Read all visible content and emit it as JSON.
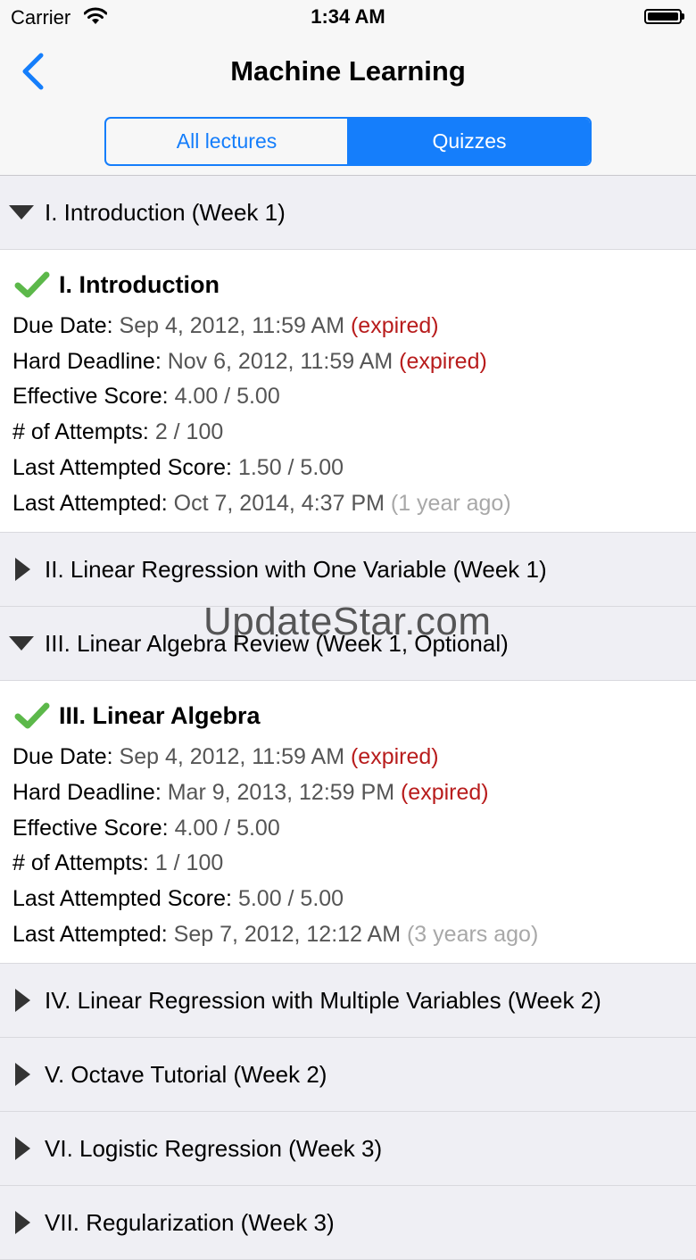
{
  "status": {
    "carrier": "Carrier",
    "time": "1:34 AM"
  },
  "nav": {
    "title": "Machine Learning",
    "tabs": [
      {
        "label": "All lectures",
        "active": false
      },
      {
        "label": "Quizzes",
        "active": true
      }
    ]
  },
  "sections": [
    {
      "title": "I. Introduction (Week 1)",
      "expanded": true,
      "quiz": {
        "title": "I. Introduction",
        "due_label": "Due Date:",
        "due_value": "Sep 4, 2012, 11:59 AM",
        "due_status": "(expired)",
        "hard_label": "Hard Deadline:",
        "hard_value": "Nov 6, 2012, 11:59 AM",
        "hard_status": "(expired)",
        "score_label": "Effective Score:",
        "score_value": "4.00 / 5.00",
        "attempts_label": "# of Attempts:",
        "attempts_value": "2 / 100",
        "last_score_label": "Last Attempted Score:",
        "last_score_value": "1.50 / 5.00",
        "last_label": "Last Attempted:",
        "last_value": "Oct 7, 2014, 4:37 PM",
        "last_ago": "(1 year ago)"
      }
    },
    {
      "title": "II. Linear Regression with One Variable (Week 1)",
      "expanded": false
    },
    {
      "title": "III. Linear Algebra Review (Week 1, Optional)",
      "expanded": true,
      "quiz": {
        "title": "III. Linear Algebra",
        "due_label": "Due Date:",
        "due_value": "Sep 4, 2012, 11:59 AM",
        "due_status": "(expired)",
        "hard_label": "Hard Deadline:",
        "hard_value": "Mar 9, 2013, 12:59 PM",
        "hard_status": "(expired)",
        "score_label": "Effective Score:",
        "score_value": "4.00 / 5.00",
        "attempts_label": "# of Attempts:",
        "attempts_value": "1 / 100",
        "last_score_label": "Last Attempted Score:",
        "last_score_value": "5.00 / 5.00",
        "last_label": "Last Attempted:",
        "last_value": "Sep 7, 2012, 12:12 AM",
        "last_ago": "(3 years ago)"
      }
    },
    {
      "title": "IV. Linear Regression with Multiple Variables (Week 2)",
      "expanded": false
    },
    {
      "title": "V. Octave Tutorial (Week 2)",
      "expanded": false
    },
    {
      "title": "VI. Logistic Regression (Week 3)",
      "expanded": false
    },
    {
      "title": "VII. Regularization (Week 3)",
      "expanded": false
    }
  ],
  "watermark": "UpdateStar.com",
  "colors": {
    "accent": "#157efb",
    "expired": "#b81c1c",
    "check": "#5cb84a"
  }
}
